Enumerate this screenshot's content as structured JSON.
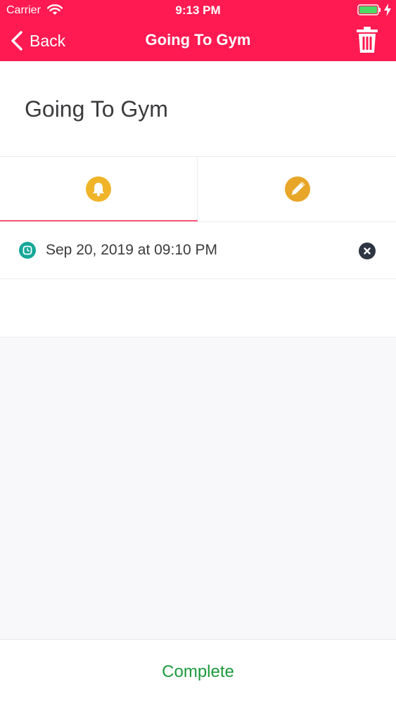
{
  "status_bar": {
    "carrier": "Carrier",
    "time": "9:13 PM"
  },
  "nav": {
    "back_label": "Back",
    "title": "Going To Gym"
  },
  "task": {
    "title": "Going To Gym"
  },
  "tabs": [
    {
      "icon": "bell-icon",
      "selected": true
    },
    {
      "icon": "pencil-icon",
      "selected": false
    }
  ],
  "reminder": {
    "datetime": "Sep 20, 2019 at 09:10 PM"
  },
  "footer": {
    "complete_label": "Complete"
  },
  "colors": {
    "header": "#ff1a52",
    "tab_icon": "#f0b429",
    "tab_indicator": "#ff5a7a",
    "alarm_icon": "#17a89a",
    "remove_icon": "#2d3442",
    "complete_text": "#1e9a3c"
  }
}
